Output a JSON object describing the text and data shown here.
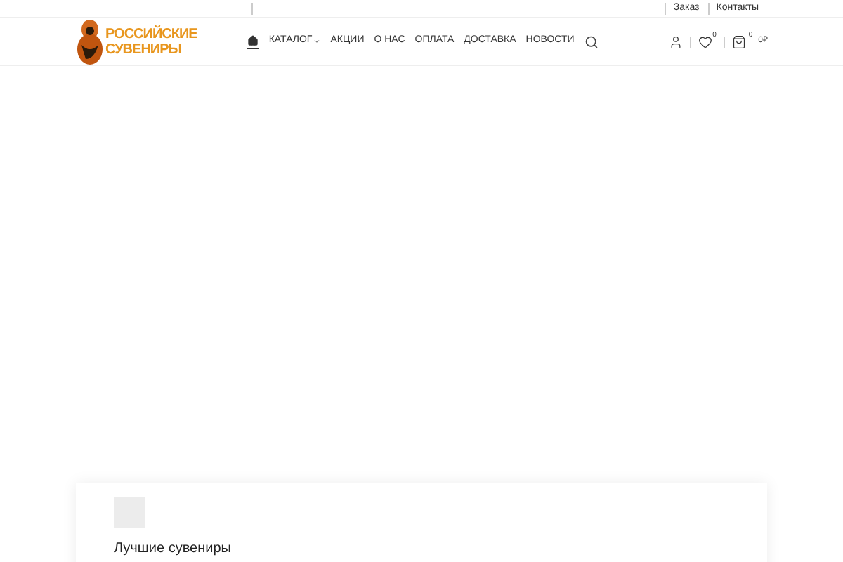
{
  "top_bar": {
    "links": [
      "Заказ",
      "Контакты"
    ]
  },
  "logo": {
    "lines": [
      "РОССИЙСКИЕ",
      "СУВЕНИРЫ"
    ]
  },
  "nav": {
    "items": [
      {
        "kind": "home",
        "selected": true
      },
      {
        "kind": "text",
        "label": "КАТАЛОГ",
        "dropdown": true,
        "selected": false
      },
      {
        "kind": "text",
        "label": "АКЦИИ",
        "dropdown": false,
        "selected": false
      },
      {
        "kind": "text",
        "label": "О НАС",
        "dropdown": false,
        "selected": false
      },
      {
        "kind": "text",
        "label": "ОПЛАТА",
        "dropdown": false,
        "selected": false
      },
      {
        "kind": "text",
        "label": "ДОСТАВКА",
        "dropdown": false,
        "selected": false
      },
      {
        "kind": "text",
        "label": "НОВОСТИ",
        "dropdown": false,
        "selected": false
      }
    ]
  },
  "header_actions": {
    "wishlist_count": "0",
    "cart_count": "0",
    "cart_total": "0₽"
  },
  "card": {
    "title": "Лучшие сувениры"
  }
}
